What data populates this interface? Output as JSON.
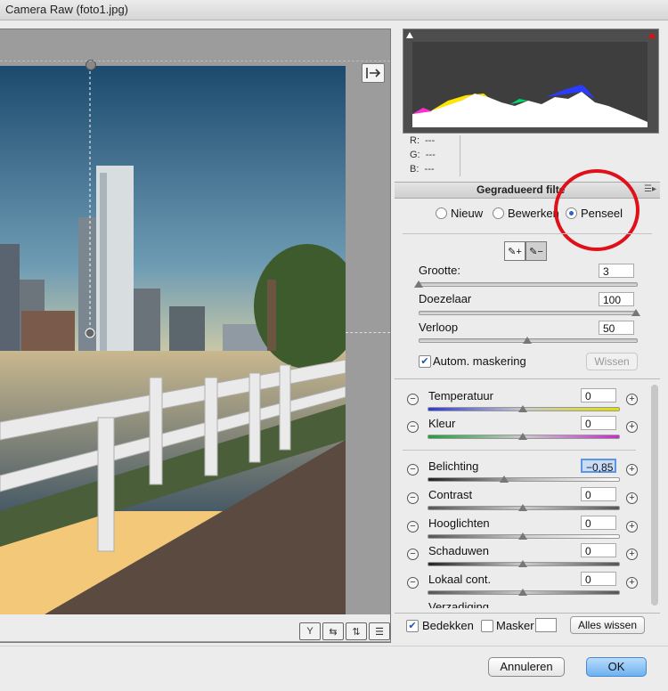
{
  "window": {
    "title": "Camera Raw (foto1.jpg)"
  },
  "rgb_readout": {
    "r_label": "R:",
    "g_label": "G:",
    "b_label": "B:",
    "r_value": "---",
    "g_value": "---",
    "b_value": "---"
  },
  "panel": {
    "title": "Gegradueerd filte"
  },
  "mode": {
    "new_label": "Nieuw",
    "edit_label": "Bewerken",
    "brush_label": "Penseel",
    "selected": "Penseel"
  },
  "brush": {
    "size_label": "Grootte:",
    "size_value": "3",
    "size_pos": 0,
    "feather_label": "Doezelaar",
    "feather_value": "100",
    "feather_pos": 1,
    "flow_label": "Verloop",
    "flow_value": "50",
    "flow_pos": 0.5,
    "automask_label": "Autom. maskering",
    "automask_checked": true,
    "clear_label": "Wissen"
  },
  "adjustments": [
    {
      "label": "Temperatuur",
      "value": "0",
      "pos": 0.5
    },
    {
      "label": "Kleur",
      "value": "0",
      "pos": 0.5
    },
    {
      "label": "Belichting",
      "value": "−0,85",
      "pos": 0.4
    },
    {
      "label": "Contrast",
      "value": "0",
      "pos": 0.5
    },
    {
      "label": "Hooglichten",
      "value": "0",
      "pos": 0.5
    },
    {
      "label": "Schaduwen",
      "value": "0",
      "pos": 0.5
    },
    {
      "label": "Lokaal cont.",
      "value": "0",
      "pos": 0.5
    },
    {
      "label": "Verzadiging",
      "value": "",
      "pos": 0.5
    }
  ],
  "footer": {
    "overlay_label": "Bedekken",
    "overlay_checked": true,
    "mask_label": "Masker",
    "mask_checked": false,
    "clear_all_label": "Alles wissen"
  },
  "dialog": {
    "cancel_label": "Annuleren",
    "ok_label": "OK"
  },
  "colors": {
    "accent": "#2a63c9",
    "highlight_ring": "#e0101a",
    "ok_button": "#6db1f0"
  }
}
